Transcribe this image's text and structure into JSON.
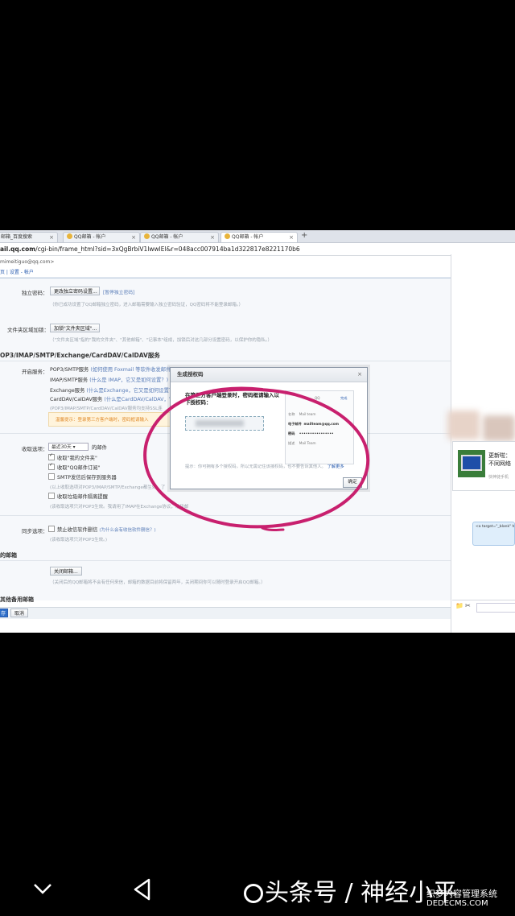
{
  "browser": {
    "tabs": [
      "邮箱_百度搜索",
      "QQ邮箱 - 帐户",
      "QQ邮箱 - 帐户",
      "QQ邮箱 - 帐户"
    ],
    "new_tab": "+",
    "url_bold": "ail.qq.com",
    "url_rest": "/cgi-bin/frame_html?sid=3xQgBrbiV1lwwlEl&r=048acc007914ba1d322817e8221170b6"
  },
  "account": "mimeitiguo@qq.com>",
  "breadcrumb": "页 | 设置 - 帐户",
  "settings": {
    "indep_pwd_label": "独立密码：",
    "indep_pwd_btn": "更改独立密码设置...",
    "indep_pwd_link": "[暂停独立密码]",
    "indep_pwd_hint": "（你已成功设置了QQ邮箱独立密码，进入邮箱需要输入独立密码验证，QQ密码将不能登录邮箱。）",
    "folder_pwd_label": "文件夹区域加锁：",
    "folder_pwd_btn": "加锁\"文件夹区域\"...",
    "folder_pwd_hint": "（\"文件夹区域\"指的\"我的文件夹\"、\"其他邮箱\"、\"记事本\"组成，加锁后对这几部分设置密码，以保护你的隐私。）",
    "pop_section": "OP3/IMAP/SMTP/Exchange/CardDAV/CalDAV服务",
    "open_service_label": "开启服务：",
    "svc1": "POP3/SMTP服务",
    "svc1_link": "(如何使用 Foxmail 等软件收发邮件？)",
    "svc2": "IMAP/SMTP服务",
    "svc2_link": "(什么是 IMAP，它又是如何设置？)",
    "svc3": "Exchange服务",
    "svc3_link": "(什么是Exchange，它又是如何设置？)",
    "svc4": "CardDAV/CalDAV服务",
    "svc4_link": "(什么是CardDAV/CalDAV，它又",
    "svc_hint": "(POP3/IMAP/SMTP/CardDAV/CalDAV服务均支持SSL连",
    "warn": "温馨提示：登录第三方客户端时，密码框请输入",
    "recv_label": "收取选项：",
    "recv_select": "最近30天",
    "recv_suffix": "的邮件",
    "opt1": "收取\"我的文件夹\"",
    "opt2": "收取\"QQ邮件订阅\"",
    "opt3": "SMTP发信后保存到服务器",
    "opt3_hint": "(以上收取选项对POP3/IMAP/SMTP/Exchange都生效。了",
    "opt4": "收取垃圾邮件隔离提醒",
    "opt4_hint": "(该收取选项只对POP3生效。我请用了IMAP在Exchange协议，垃圾邮",
    "sync_label": "同步选项：",
    "sync_opt": "禁止收信软件删信",
    "sync_link": "(为什么会有收信软件删信？)",
    "sync_hint": "(该收取选项只对POP3生效。)",
    "close_section": "的邮箱",
    "close_btn": "关闭邮箱...",
    "close_hint": "（关闭后的QQ邮箱将不会有任何来信，邮箱的数据目前将保留两年，关闭期间你可以随时登录开启QQ邮箱。）",
    "other_section": "其他备用邮箱",
    "save_btn": "存",
    "cancel_btn": "取消"
  },
  "modal": {
    "title": "生成授权码",
    "message": "在第三方客户端登录时，密码框请输入以下授权码：",
    "phone_rows": [
      {
        "k": "QQ",
        "v": "QQ"
      },
      {
        "k": "名称",
        "v": "Mail team"
      },
      {
        "k": "电子邮件",
        "v": "mailteam@qq.com"
      },
      {
        "k": "密码",
        "v": "••••••••••••••••"
      },
      {
        "k": "描述",
        "v": "Mail Team"
      }
    ],
    "phone_top_right": "完成",
    "tip": "提示：你可拥有多个授权码，所以无需记住该授权码，也不要告诉其他人。",
    "tip_link": "了解更多",
    "ok": "确定"
  },
  "chat": {
    "line1": "更新啦：",
    "line2": "不同网络",
    "line3": "快神徒手机",
    "code": "<a target=\"_blank\" h... bin/qm_share?t=qm_... www.Ga09-d\" style=\"...",
    "tools": [
      "📁",
      "✂"
    ]
  },
  "overlay": {
    "watermark": "头条号 / 神经小平",
    "site_a": "织梦内容管理系统",
    "site_b": "DEDECMS.COM"
  },
  "colors": {
    "annotation": "#c8206e",
    "background": "#000000"
  }
}
